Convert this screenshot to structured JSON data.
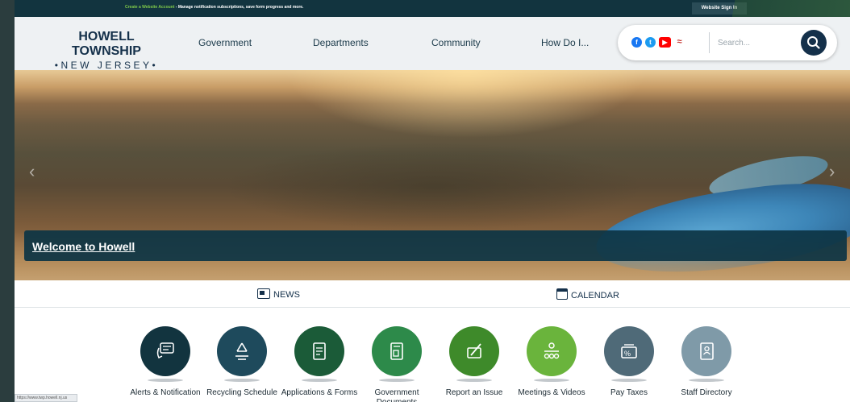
{
  "topbar": {
    "create_account_link": "Create a Website Account",
    "message": " - Manage notification subscriptions, save form progress and more.",
    "sign_in": "Website Sign In"
  },
  "logo": {
    "line1": "HOWELL TOWNSHIP",
    "line2": "•NEW JERSEY•"
  },
  "nav": [
    "Government",
    "Departments",
    "Community",
    "How Do I..."
  ],
  "social": {
    "icons": [
      "facebook-icon",
      "twitter-icon",
      "youtube-icon",
      "flag-icon"
    ],
    "colors": [
      "#1877f2",
      "#1d9bf0",
      "#ff0000",
      "#c4302b"
    ]
  },
  "search": {
    "placeholder": "Search..."
  },
  "hero": {
    "welcome": "Welcome to Howell"
  },
  "tabs": {
    "news": "NEWS",
    "calendar": "CALENDAR"
  },
  "quick_links": [
    {
      "label": "Alerts & Notification",
      "color": "#12343f",
      "icon": "alert-chat-icon"
    },
    {
      "label": "Recycling Schedule",
      "color": "#1e4a5c",
      "icon": "recycle-icon"
    },
    {
      "label": "Applications & Forms",
      "color": "#1b5b38",
      "icon": "document-icon"
    },
    {
      "label": "Government Documents",
      "color": "#2d8a4a",
      "icon": "legal-document-icon"
    },
    {
      "label": "Report an Issue",
      "color": "#3e8a2a",
      "icon": "report-pen-icon"
    },
    {
      "label": "Meetings & Videos",
      "color": "#6ab43c",
      "icon": "meeting-icon"
    },
    {
      "label": "Pay Taxes",
      "color": "#4f6a78",
      "icon": "pay-taxes-icon"
    },
    {
      "label": "Staff Directory",
      "color": "#7f9aa8",
      "icon": "directory-icon"
    }
  ],
  "statusbar": "https://www.twp.howell.nj.us"
}
